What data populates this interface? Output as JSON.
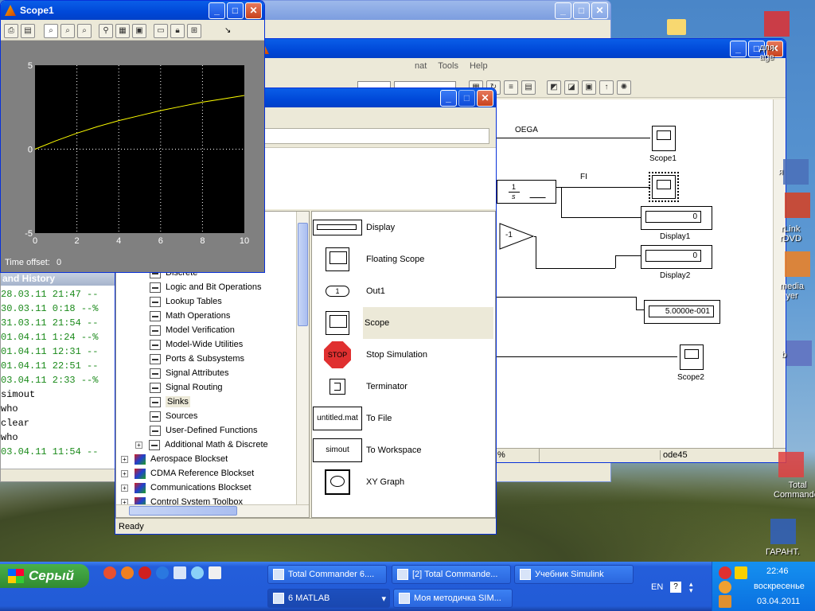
{
  "scope": {
    "title": "Scope1",
    "y_ticks": [
      "5",
      "0",
      "-5"
    ],
    "x_ticks": [
      "0",
      "2",
      "4",
      "6",
      "8",
      "10"
    ],
    "time_offset_label": "Time offset:",
    "time_offset_value": "0",
    "trace_color": "#ffff00"
  },
  "chart_data": {
    "type": "line",
    "title": "",
    "xlabel": "",
    "ylabel": "",
    "xlim": [
      0,
      10
    ],
    "ylim": [
      -5,
      5
    ],
    "grid": true,
    "x": [
      0,
      1,
      2,
      3,
      4,
      5,
      6,
      7,
      8,
      9,
      10
    ],
    "series": [
      {
        "values": [
          0,
          0.5,
          0.95,
          1.35,
          1.7,
          2.0,
          2.3,
          2.55,
          2.8,
          3.0,
          3.2
        ]
      }
    ]
  },
  "model": {
    "menu": [
      "nat",
      "Tools",
      "Help"
    ],
    "signals": {
      "oega": "OEGA",
      "fi": "FI"
    },
    "integrator": {
      "num": "1",
      "den": "s"
    },
    "gain": "-1",
    "blocks": {
      "scope1": "Scope1",
      "display1": "Display1",
      "display1_value": "0",
      "display2": "Display2",
      "display2_value": "0",
      "display3_value": "5.0000e-001",
      "scope2": "Scope2"
    },
    "status_pct": "%",
    "status_solver": "ode45"
  },
  "library": {
    "tree": [
      {
        "label": "Discrete",
        "kind": "sub"
      },
      {
        "label": "Logic and Bit Operations",
        "kind": "sub"
      },
      {
        "label": "Lookup Tables",
        "kind": "sub"
      },
      {
        "label": "Math Operations",
        "kind": "sub"
      },
      {
        "label": "Model Verification",
        "kind": "sub"
      },
      {
        "label": "Model-Wide Utilities",
        "kind": "sub"
      },
      {
        "label": "Ports & Subsystems",
        "kind": "sub"
      },
      {
        "label": "Signal Attributes",
        "kind": "sub"
      },
      {
        "label": "Signal Routing",
        "kind": "sub"
      },
      {
        "label": "Sinks",
        "kind": "sub"
      },
      {
        "label": "Sources",
        "kind": "sub"
      },
      {
        "label": "User-Defined Functions",
        "kind": "sub"
      },
      {
        "label": "Additional Math & Discrete",
        "kind": "subplus"
      },
      {
        "label": "Aerospace Blockset",
        "kind": "top"
      },
      {
        "label": "CDMA Reference Blockset",
        "kind": "top"
      },
      {
        "label": "Communications Blockset",
        "kind": "top"
      },
      {
        "label": "Control System Toolbox",
        "kind": "top"
      }
    ],
    "sinks": [
      {
        "name": "Display",
        "icon": "display"
      },
      {
        "name": "Floating Scope",
        "icon": "scope"
      },
      {
        "name": "Out1",
        "icon": "out",
        "icon_text": "1"
      },
      {
        "name": "Scope",
        "icon": "scope"
      },
      {
        "name": "Stop Simulation",
        "icon": "stop",
        "icon_text": "STOP"
      },
      {
        "name": "Terminator",
        "icon": "term"
      },
      {
        "name": "To File",
        "icon": "text",
        "icon_text": "untitled.mat"
      },
      {
        "name": "To Workspace",
        "icon": "text",
        "icon_text": "simout"
      },
      {
        "name": "XY Graph",
        "icon": "xy"
      }
    ],
    "selected_sink": "Scope",
    "status": "Ready"
  },
  "history": {
    "title": "and History",
    "lines": [
      {
        "text": "  28.03.11 21:47 --",
        "color": "#1a8a1a"
      },
      {
        "text": "  30.03.11 0:18 --%",
        "color": "#1a8a1a"
      },
      {
        "text": "  31.03.11 21:54 --",
        "color": "#1a8a1a"
      },
      {
        "text": "  01.04.11 1:24 --%",
        "color": "#1a8a1a"
      },
      {
        "text": "  01.04.11 12:31 --",
        "color": "#1a8a1a"
      },
      {
        "text": "  01.04.11 22:51 --",
        "color": "#1a8a1a"
      },
      {
        "text": "  03.04.11 2:33 --%",
        "color": "#1a8a1a"
      },
      {
        "text": "simout",
        "color": "#000000"
      },
      {
        "text": "who",
        "color": "#000000"
      },
      {
        "text": "clear",
        "color": "#000000"
      },
      {
        "text": "who",
        "color": "#000000"
      },
      {
        "text": "  03.04.11 11:54 --",
        "color": "#1a8a1a"
      }
    ]
  },
  "desktop": {
    "icons": [
      {
        "label": "для",
        "label2": "age"
      },
      {
        "label": "я",
        "label2": ""
      },
      {
        "label": "rLink",
        "label2": "rDVD"
      },
      {
        "label": "media",
        "label2": "yer"
      },
      {
        "label": "b",
        "label2": ""
      },
      {
        "label": "Total",
        "label2": "Commander"
      },
      {
        "label": "ГАРАНТ.",
        "label2": ""
      }
    ]
  },
  "taskbar": {
    "start_label": "Серый",
    "tasks_top": [
      "Total Commander 6....",
      "[2] Total Commande...",
      "Учебник Simulink"
    ],
    "tasks_bottom": [
      {
        "label": "6 MATLAB"
      },
      {
        "label": "Моя методичка SIM..."
      }
    ],
    "lang": "EN",
    "time": "22:46",
    "day": "воскресенье",
    "date": "03.04.2011"
  }
}
